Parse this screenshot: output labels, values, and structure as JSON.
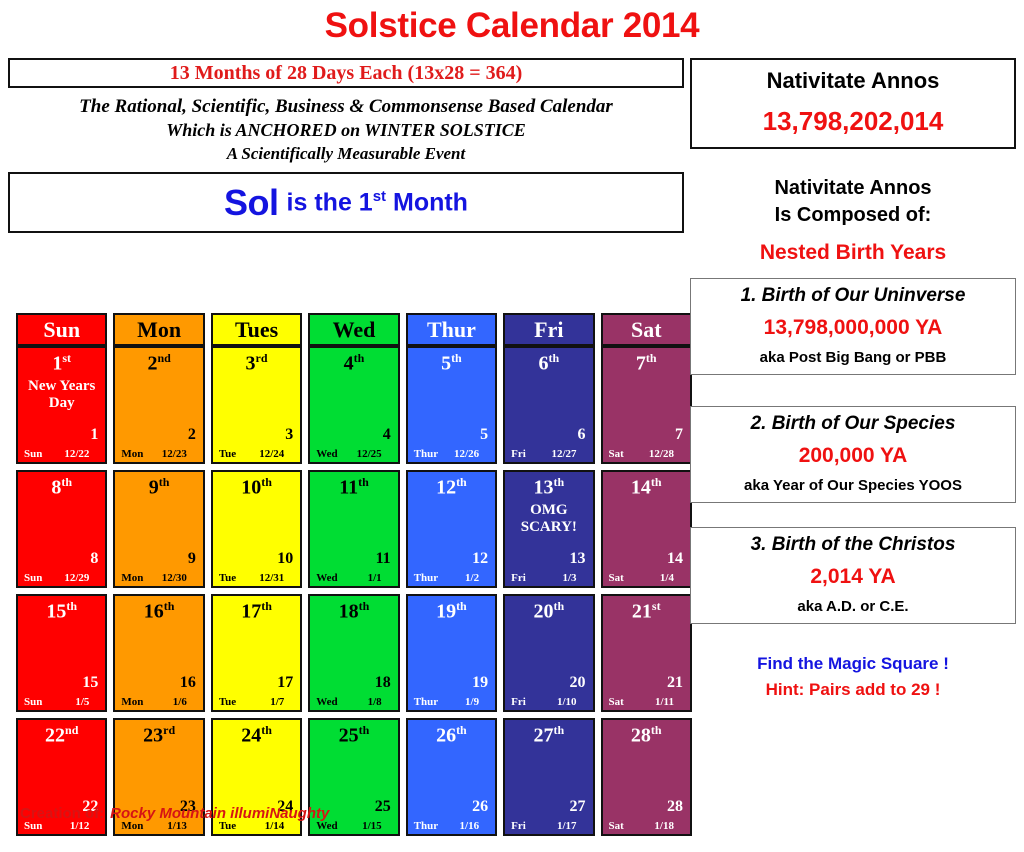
{
  "title": "Solstice Calendar 2014",
  "subtitle": "13 Months of 28 Days Each (13x28 = 364)",
  "tagline": {
    "line1": "The Rational, Scientific, Business & Commonsense Based Calendar",
    "line2": "Which is ANCHORED on WINTER SOLSTICE",
    "line3": "A Scientifically Measurable Event"
  },
  "month_banner": {
    "name": "Sol",
    "rest_before": "is the 1",
    "rest_sup": "st",
    "rest_after": " Month"
  },
  "colors": {
    "sun": "#FF0000",
    "mon": "#FF9900",
    "tues": "#FFFF00",
    "wed": "#00DD33",
    "thur": "#3366FF",
    "fri": "#333399",
    "sat": "#993366",
    "accent_red": "#EF1111",
    "accent_blue": "#1414E0",
    "border": "#111111"
  },
  "weekday_headers": [
    {
      "label": "Sun",
      "bg": "#FF0000",
      "fg": "#FFFFFF"
    },
    {
      "label": "Mon",
      "bg": "#FF9900",
      "fg": "#000000"
    },
    {
      "label": "Tues",
      "bg": "#FFFF00",
      "fg": "#000000"
    },
    {
      "label": "Wed",
      "bg": "#00DD33",
      "fg": "#000000"
    },
    {
      "label": "Thur",
      "bg": "#3366FF",
      "fg": "#FFFFFF"
    },
    {
      "label": "Fri",
      "bg": "#333399",
      "fg": "#FFFFFF"
    },
    {
      "label": "Sat",
      "bg": "#993366",
      "fg": "#FFFFFF"
    }
  ],
  "calendar_rows": [
    [
      {
        "ordinal": "1",
        "suffix": "st",
        "note": "New Years\nDay",
        "number": "1",
        "dow": "Sun",
        "greg": "12/22",
        "bg": "#FF0000",
        "fg": "#FFFFFF"
      },
      {
        "ordinal": "2",
        "suffix": "nd",
        "note": "",
        "number": "2",
        "dow": "Mon",
        "greg": "12/23",
        "bg": "#FF9900",
        "fg": "#000000"
      },
      {
        "ordinal": "3",
        "suffix": "rd",
        "note": "",
        "number": "3",
        "dow": "Tue",
        "greg": "12/24",
        "bg": "#FFFF00",
        "fg": "#000000"
      },
      {
        "ordinal": "4",
        "suffix": "th",
        "note": "",
        "number": "4",
        "dow": "Wed",
        "greg": "12/25",
        "bg": "#00DD33",
        "fg": "#000000"
      },
      {
        "ordinal": "5",
        "suffix": "th",
        "note": "",
        "number": "5",
        "dow": "Thur",
        "greg": "12/26",
        "bg": "#3366FF",
        "fg": "#FFFFFF"
      },
      {
        "ordinal": "6",
        "suffix": "th",
        "note": "",
        "number": "6",
        "dow": "Fri",
        "greg": "12/27",
        "bg": "#333399",
        "fg": "#FFFFFF"
      },
      {
        "ordinal": "7",
        "suffix": "th",
        "note": "",
        "number": "7",
        "dow": "Sat",
        "greg": "12/28",
        "bg": "#993366",
        "fg": "#FFFFFF"
      }
    ],
    [
      {
        "ordinal": "8",
        "suffix": "th",
        "note": "",
        "number": "8",
        "dow": "Sun",
        "greg": "12/29",
        "bg": "#FF0000",
        "fg": "#FFFFFF"
      },
      {
        "ordinal": "9",
        "suffix": "th",
        "note": "",
        "number": "9",
        "dow": "Mon",
        "greg": "12/30",
        "bg": "#FF9900",
        "fg": "#000000"
      },
      {
        "ordinal": "10",
        "suffix": "th",
        "note": "",
        "number": "10",
        "dow": "Tue",
        "greg": "12/31",
        "bg": "#FFFF00",
        "fg": "#000000"
      },
      {
        "ordinal": "11",
        "suffix": "th",
        "note": "",
        "number": "11",
        "dow": "Wed",
        "greg": "1/1",
        "bg": "#00DD33",
        "fg": "#000000"
      },
      {
        "ordinal": "12",
        "suffix": "th",
        "note": "",
        "number": "12",
        "dow": "Thur",
        "greg": "1/2",
        "bg": "#3366FF",
        "fg": "#FFFFFF"
      },
      {
        "ordinal": "13",
        "suffix": "th",
        "note": "OMG\nSCARY!",
        "number": "13",
        "dow": "Fri",
        "greg": "1/3",
        "bg": "#333399",
        "fg": "#FFFFFF"
      },
      {
        "ordinal": "14",
        "suffix": "th",
        "note": "",
        "number": "14",
        "dow": "Sat",
        "greg": "1/4",
        "bg": "#993366",
        "fg": "#FFFFFF"
      }
    ],
    [
      {
        "ordinal": "15",
        "suffix": "th",
        "note": "",
        "number": "15",
        "dow": "Sun",
        "greg": "1/5",
        "bg": "#FF0000",
        "fg": "#FFFFFF"
      },
      {
        "ordinal": "16",
        "suffix": "th",
        "note": "",
        "number": "16",
        "dow": "Mon",
        "greg": "1/6",
        "bg": "#FF9900",
        "fg": "#000000"
      },
      {
        "ordinal": "17",
        "suffix": "th",
        "note": "",
        "number": "17",
        "dow": "Tue",
        "greg": "1/7",
        "bg": "#FFFF00",
        "fg": "#000000"
      },
      {
        "ordinal": "18",
        "suffix": "th",
        "note": "",
        "number": "18",
        "dow": "Wed",
        "greg": "1/8",
        "bg": "#00DD33",
        "fg": "#000000"
      },
      {
        "ordinal": "19",
        "suffix": "th",
        "note": "",
        "number": "19",
        "dow": "Thur",
        "greg": "1/9",
        "bg": "#3366FF",
        "fg": "#FFFFFF"
      },
      {
        "ordinal": "20",
        "suffix": "th",
        "note": "",
        "number": "20",
        "dow": "Fri",
        "greg": "1/10",
        "bg": "#333399",
        "fg": "#FFFFFF"
      },
      {
        "ordinal": "21",
        "suffix": "st",
        "note": "",
        "number": "21",
        "dow": "Sat",
        "greg": "1/11",
        "bg": "#993366",
        "fg": "#FFFFFF"
      }
    ],
    [
      {
        "ordinal": "22",
        "suffix": "nd",
        "note": "",
        "number": "22",
        "dow": "Sun",
        "greg": "1/12",
        "bg": "#FF0000",
        "fg": "#FFFFFF"
      },
      {
        "ordinal": "23",
        "suffix": "rd",
        "note": "",
        "number": "23",
        "dow": "Mon",
        "greg": "1/13",
        "bg": "#FF9900",
        "fg": "#000000"
      },
      {
        "ordinal": "24",
        "suffix": "th",
        "note": "",
        "number": "24",
        "dow": "Tue",
        "greg": "1/14",
        "bg": "#FFFF00",
        "fg": "#000000"
      },
      {
        "ordinal": "25",
        "suffix": "th",
        "note": "",
        "number": "25",
        "dow": "Wed",
        "greg": "1/15",
        "bg": "#00DD33",
        "fg": "#000000"
      },
      {
        "ordinal": "26",
        "suffix": "th",
        "note": "",
        "number": "26",
        "dow": "Thur",
        "greg": "1/16",
        "bg": "#3366FF",
        "fg": "#FFFFFF"
      },
      {
        "ordinal": "27",
        "suffix": "th",
        "note": "",
        "number": "27",
        "dow": "Fri",
        "greg": "1/17",
        "bg": "#333399",
        "fg": "#FFFFFF"
      },
      {
        "ordinal": "28",
        "suffix": "th",
        "note": "",
        "number": "28",
        "dow": "Sat",
        "greg": "1/18",
        "bg": "#993366",
        "fg": "#FFFFFF"
      }
    ]
  ],
  "sidebar": {
    "nativitate_title": "Nativitate Annos",
    "nativitate_number": "13,798,202,014",
    "composed_line1": "Nativitate Annos",
    "composed_line2": "Is Composed of:",
    "nested_birth_years": "Nested Birth Years",
    "births": [
      {
        "title": "1. Birth of Our Uninverse",
        "number": "13,798,000,000 YA",
        "aka": "aka Post Big Bang or PBB"
      },
      {
        "title": "2. Birth of Our Species",
        "number": "200,000 YA",
        "aka": "aka Year of Our Species YOOS"
      },
      {
        "title": "3. Birth of the Christos",
        "number": "2,014 YA",
        "aka": "aka A.D. or C.E."
      }
    ],
    "magic_line1": "Find the Magic Square !",
    "magic_line2": "Hint: Pairs add to 29 !"
  },
  "footer": {
    "label": "Creation of:",
    "author": "Rocky Mountain illumiNaughty"
  }
}
